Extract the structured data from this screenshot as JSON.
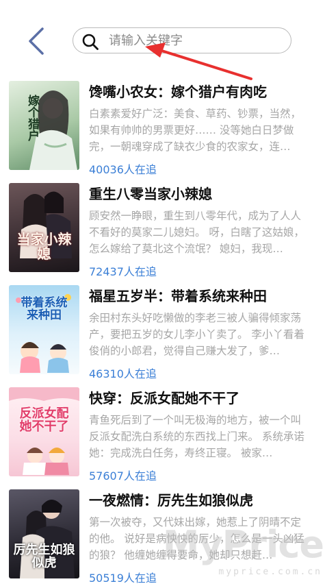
{
  "search": {
    "placeholder": "请输入关键字"
  },
  "books": [
    {
      "title": "馋嘴小农女：嫁个猎户有肉吃",
      "description": "白素素爱好广泛：美食、草药、钞票，当然，如果有帅帅的男票更好…… 没等她白日梦做完，一朝魂穿成了缺衣少食的农家女，连…",
      "readers": "40036人在追",
      "cover_text": "嫁个猎户",
      "cover_colors": [
        "#cfe3c8",
        "#6e9a72"
      ]
    },
    {
      "title": "重生八零当家小辣媳",
      "description": "顾安然一睁眼，重生到八零年代，成为了人人不看好的莫家二儿媳妇。 呀，白瞎了这姑娘，怎么嫁给了莫北这个流氓？ 媳妇，我现…",
      "readers": "72437人在追",
      "cover_text": "当家小辣媳",
      "cover_colors": [
        "#4b3a3e",
        "#1f1a1f"
      ]
    },
    {
      "title": "福星五岁半：带着系统来种田",
      "description": "余田村东头好吃懒做的李老三被人骗得倾家荡产，要把五岁的女儿李小丫卖了。 李小丫看着俊俏的小郎君，觉得自己赚大发了，爹…",
      "readers": "46310人在追",
      "cover_text": "带着系统来种田",
      "cover_colors": [
        "#bfe2f6",
        "#eef7fb"
      ]
    },
    {
      "title": "快穿：反派女配她不干了",
      "description": "青鱼死后到了一个叫无极海的地方，被一个叫反派女配洗白系统的东西找上门来。 系统承诺她：完成洗白任务，寿终正寝。 被家…",
      "readers": "57607人在追",
      "cover_text": "反派女配她不干了",
      "cover_colors": [
        "#fbe3ea",
        "#f7c9d6"
      ]
    },
    {
      "title": "一夜燃情：厉先生如狼似虎",
      "description": "第一次被夺，又代妹出嫁，她惹上了阴晴不定的他。 说好是病怏怏的厉少，怎么是一头凶猛的狼？ 他缠她缠得要命，她却只想赶…",
      "readers": "50519人在追",
      "cover_text": "厉先生如狼似虎",
      "cover_colors": [
        "#3a3a45",
        "#1b1b22"
      ]
    }
  ],
  "watermark": {
    "main": "MyPrice",
    "sub": "myprice.com.cn"
  },
  "colors": {
    "accent": "#3b7fd6",
    "annotation": "#e8302f",
    "back_arrow": "#5b6fa6"
  }
}
